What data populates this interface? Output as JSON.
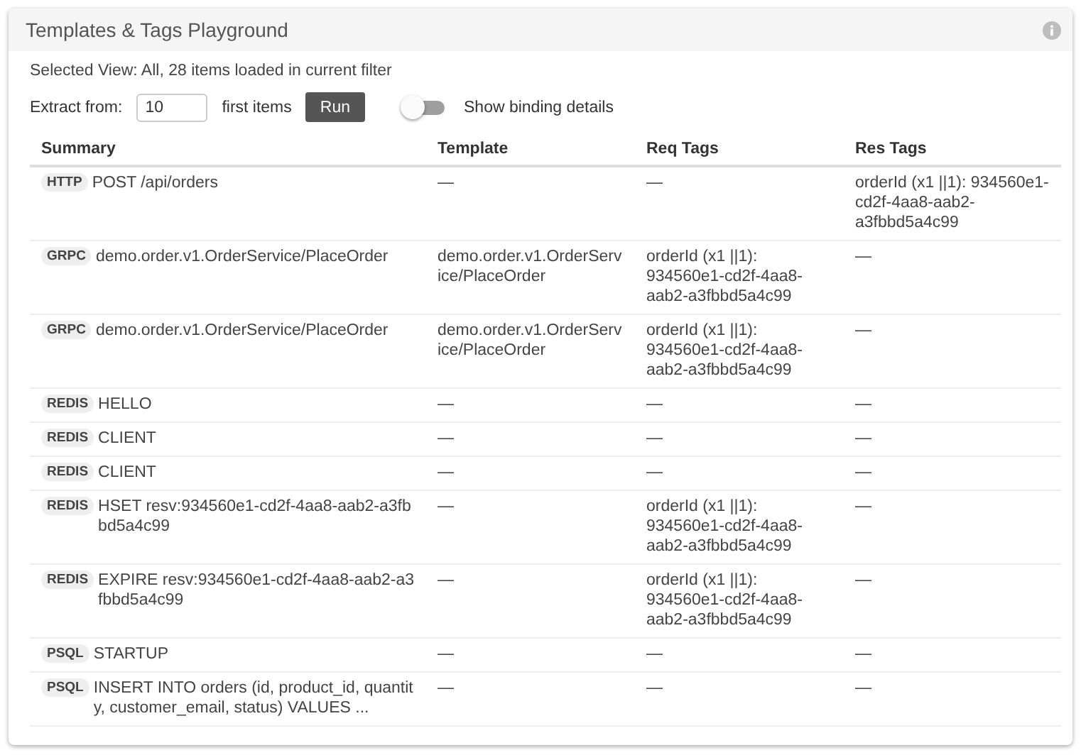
{
  "panel": {
    "title": "Templates & Tags Playground"
  },
  "selected_view": "Selected View: All, 28 items loaded in current filter",
  "extract": {
    "label": "Extract from:",
    "value": "10",
    "suffix": "first items",
    "button": "Run"
  },
  "toggle": {
    "label": "Show binding details",
    "on": false
  },
  "table": {
    "columns": [
      "Summary",
      "Template",
      "Req Tags",
      "Res Tags"
    ],
    "rows": [
      {
        "method": "HTTP",
        "summary": "POST /api/orders",
        "template": "—",
        "req_tags": "—",
        "res_tags": "orderId (x1 ||1): 934560e1-cd2f-4aa8-aab2-a3fbbd5a4c99"
      },
      {
        "method": "GRPC",
        "summary": "demo.order.v1.OrderService/PlaceOrder",
        "template": "demo.order.v1.OrderService/PlaceOrder",
        "req_tags": "orderId (x1 ||1): 934560e1-cd2f-4aa8-aab2-a3fbbd5a4c99",
        "res_tags": "—"
      },
      {
        "method": "GRPC",
        "summary": "demo.order.v1.OrderService/PlaceOrder",
        "template": "demo.order.v1.OrderService/PlaceOrder",
        "req_tags": "orderId (x1 ||1): 934560e1-cd2f-4aa8-aab2-a3fbbd5a4c99",
        "res_tags": "—"
      },
      {
        "method": "REDIS",
        "summary": "HELLO",
        "template": "—",
        "req_tags": "—",
        "res_tags": "—"
      },
      {
        "method": "REDIS",
        "summary": "CLIENT",
        "template": "—",
        "req_tags": "—",
        "res_tags": "—"
      },
      {
        "method": "REDIS",
        "summary": "CLIENT",
        "template": "—",
        "req_tags": "—",
        "res_tags": "—"
      },
      {
        "method": "REDIS",
        "summary": "HSET resv:934560e1-cd2f-4aa8-aab2-a3fbbd5a4c99",
        "template": "—",
        "req_tags": "orderId (x1 ||1): 934560e1-cd2f-4aa8-aab2-a3fbbd5a4c99",
        "res_tags": "—"
      },
      {
        "method": "REDIS",
        "summary": "EXPIRE resv:934560e1-cd2f-4aa8-aab2-a3fbbd5a4c99",
        "template": "—",
        "req_tags": "orderId (x1 ||1): 934560e1-cd2f-4aa8-aab2-a3fbbd5a4c99",
        "res_tags": "—"
      },
      {
        "method": "PSQL",
        "summary": "STARTUP",
        "template": "—",
        "req_tags": "—",
        "res_tags": "—"
      },
      {
        "method": "PSQL",
        "summary": "INSERT INTO orders (id, product_id, quantity, customer_email, status) VALUES ...",
        "template": "—",
        "req_tags": "—",
        "res_tags": "—"
      }
    ]
  }
}
